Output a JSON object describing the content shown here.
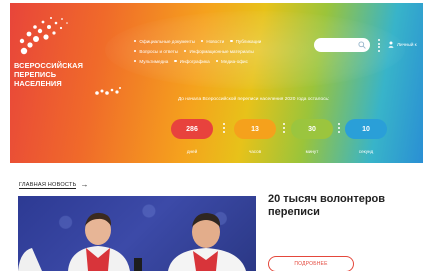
{
  "logo": {
    "lines": [
      "ВСЕРОССИЙСКАЯ",
      "ПЕРЕПИСЬ",
      "НАСЕЛЕНИЯ"
    ],
    "icon": "census-logo-icon"
  },
  "nav": {
    "row1": [
      "Официальные документы",
      "Новости",
      "Публикации"
    ],
    "row2": [
      "Вопросы и ответы",
      "Информационные материалы"
    ],
    "row3": [
      "Мультимедиа",
      "Инфографика",
      "Медиа-офис"
    ]
  },
  "search": {
    "placeholder": "",
    "icon": "search-icon"
  },
  "login": {
    "label": "Личный к",
    "icon": "user-icon"
  },
  "countdown": {
    "title": "До начала Всероссийской переписи населения 2020 года осталось:",
    "days": {
      "value": "286",
      "unit": "дней"
    },
    "hours": {
      "value": "13",
      "unit": "часов"
    },
    "minutes": {
      "value": "30",
      "unit": "минут"
    },
    "seconds": {
      "value": "10",
      "unit": "секунд"
    }
  },
  "main_news": {
    "label": "ГЛАВНАЯ НОВОСТЬ",
    "arrow": "→",
    "title": "20 тысяч волонтеров переписи",
    "more": "ПОДРОБНЕЕ"
  },
  "colors": {
    "red": "#e8423d",
    "orange": "#f5a11c",
    "green": "#9bc53e",
    "blue": "#2a9fd8",
    "accent_button": "#e4483c"
  }
}
